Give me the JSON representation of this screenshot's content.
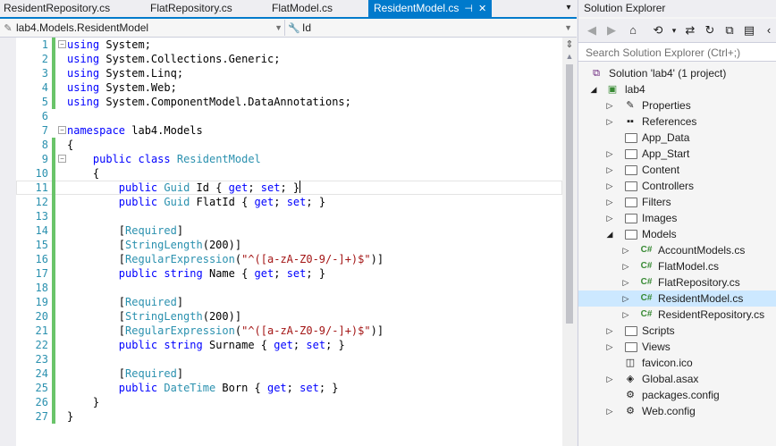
{
  "tabs": [
    {
      "label": "ResidentRepository.cs"
    },
    {
      "label": "FlatRepository.cs"
    },
    {
      "label": "FlatModel.cs"
    },
    {
      "label": "ResidentModel.cs",
      "active": true
    }
  ],
  "active_tab_icons": {
    "pin": "pin-icon",
    "close": "close-icon"
  },
  "nav": {
    "class_combo": "lab4.Models.ResidentModel",
    "member_combo": "Id"
  },
  "code_lines": [
    {
      "n": "1"
    },
    {
      "n": "2"
    },
    {
      "n": "3"
    },
    {
      "n": "4"
    },
    {
      "n": "5"
    },
    {
      "n": "6"
    },
    {
      "n": "7"
    },
    {
      "n": "8"
    },
    {
      "n": "9"
    },
    {
      "n": "10"
    },
    {
      "n": "11"
    },
    {
      "n": "12"
    },
    {
      "n": "13"
    },
    {
      "n": "14"
    },
    {
      "n": "15"
    },
    {
      "n": "16"
    },
    {
      "n": "17"
    },
    {
      "n": "18"
    },
    {
      "n": "19"
    },
    {
      "n": "20"
    },
    {
      "n": "21"
    },
    {
      "n": "22"
    },
    {
      "n": "23"
    },
    {
      "n": "24"
    },
    {
      "n": "25"
    },
    {
      "n": "26"
    },
    {
      "n": "27"
    }
  ],
  "code": {
    "l1": [
      "using",
      " System;"
    ],
    "l2": [
      "using",
      " System.Collections.Generic;"
    ],
    "l3": [
      "using",
      " System.Linq;"
    ],
    "l4": [
      "using",
      " System.Web;"
    ],
    "l5": [
      "using",
      " System.ComponentModel.DataAnnotations;"
    ],
    "l7": [
      "namespace",
      " lab4.Models"
    ],
    "l8": "{",
    "l9": [
      "    ",
      "public",
      " ",
      "class",
      " ",
      "ResidentModel"
    ],
    "l10": "    {",
    "l11": [
      "        ",
      "public",
      " ",
      "Guid",
      " Id { ",
      "get",
      "; ",
      "set",
      "; }"
    ],
    "l12": [
      "        ",
      "public",
      " ",
      "Guid",
      " FlatId { ",
      "get",
      "; ",
      "set",
      "; }"
    ],
    "l14": [
      "        [",
      "Required",
      "]"
    ],
    "l15": [
      "        [",
      "StringLength",
      "(200)]"
    ],
    "l16": [
      "        [",
      "RegularExpression",
      "(",
      "\"^([a-zA-Z0-9/-]+)$\"",
      ")]"
    ],
    "l17": [
      "        ",
      "public",
      " ",
      "string",
      " Name { ",
      "get",
      "; ",
      "set",
      "; }"
    ],
    "l19": [
      "        [",
      "Required",
      "]"
    ],
    "l20": [
      "        [",
      "StringLength",
      "(200)]"
    ],
    "l21": [
      "        [",
      "RegularExpression",
      "(",
      "\"^([a-zA-Z0-9/-]+)$\"",
      ")]"
    ],
    "l22": [
      "        ",
      "public",
      " ",
      "string",
      " Surname { ",
      "get",
      "; ",
      "set",
      "; }"
    ],
    "l24": [
      "        [",
      "Required",
      "]"
    ],
    "l25": [
      "        ",
      "public",
      " ",
      "DateTime",
      " Born { ",
      "get",
      "; ",
      "set",
      "; }"
    ],
    "l26": "    }",
    "l27": "}"
  },
  "solution_explorer": {
    "title": "Solution Explorer",
    "search_placeholder": "Search Solution Explorer (Ctrl+;)",
    "toolbar_icons": [
      "back-icon",
      "forward-icon",
      "home-icon",
      "history-icon",
      "sync-icon",
      "refresh-icon",
      "collapse-all-icon",
      "show-all-files-icon",
      "properties-icon"
    ],
    "tree": [
      {
        "label": "Solution 'lab4' (1 project)",
        "icon": "solution-icon"
      },
      {
        "label": "lab4",
        "icon": "project-icon"
      },
      {
        "label": "Properties",
        "icon": "wrench-icon"
      },
      {
        "label": "References",
        "icon": "references-icon"
      },
      {
        "label": "App_Data",
        "icon": "folder-icon"
      },
      {
        "label": "App_Start",
        "icon": "folder-icon"
      },
      {
        "label": "Content",
        "icon": "folder-icon"
      },
      {
        "label": "Controllers",
        "icon": "folder-icon"
      },
      {
        "label": "Filters",
        "icon": "folder-icon"
      },
      {
        "label": "Images",
        "icon": "folder-icon"
      },
      {
        "label": "Models",
        "icon": "folder-icon"
      },
      {
        "label": "AccountModels.cs",
        "icon": "csharp-file-icon"
      },
      {
        "label": "FlatModel.cs",
        "icon": "csharp-file-icon"
      },
      {
        "label": "FlatRepository.cs",
        "icon": "csharp-file-icon"
      },
      {
        "label": "ResidentModel.cs",
        "icon": "csharp-file-icon",
        "selected": true
      },
      {
        "label": "ResidentRepository.cs",
        "icon": "csharp-file-icon"
      },
      {
        "label": "Scripts",
        "icon": "folder-icon"
      },
      {
        "label": "Views",
        "icon": "folder-icon"
      },
      {
        "label": "favicon.ico",
        "icon": "image-file-icon"
      },
      {
        "label": "Global.asax",
        "icon": "asax-file-icon"
      },
      {
        "label": "packages.config",
        "icon": "config-file-icon"
      },
      {
        "label": "Web.config",
        "icon": "config-file-icon"
      }
    ]
  },
  "colors": {
    "accent": "#007acc",
    "selection": "#cce8ff",
    "keyword": "#0000ff",
    "type": "#2b91af",
    "string": "#a31515",
    "change_marker": "#6ac46a"
  }
}
